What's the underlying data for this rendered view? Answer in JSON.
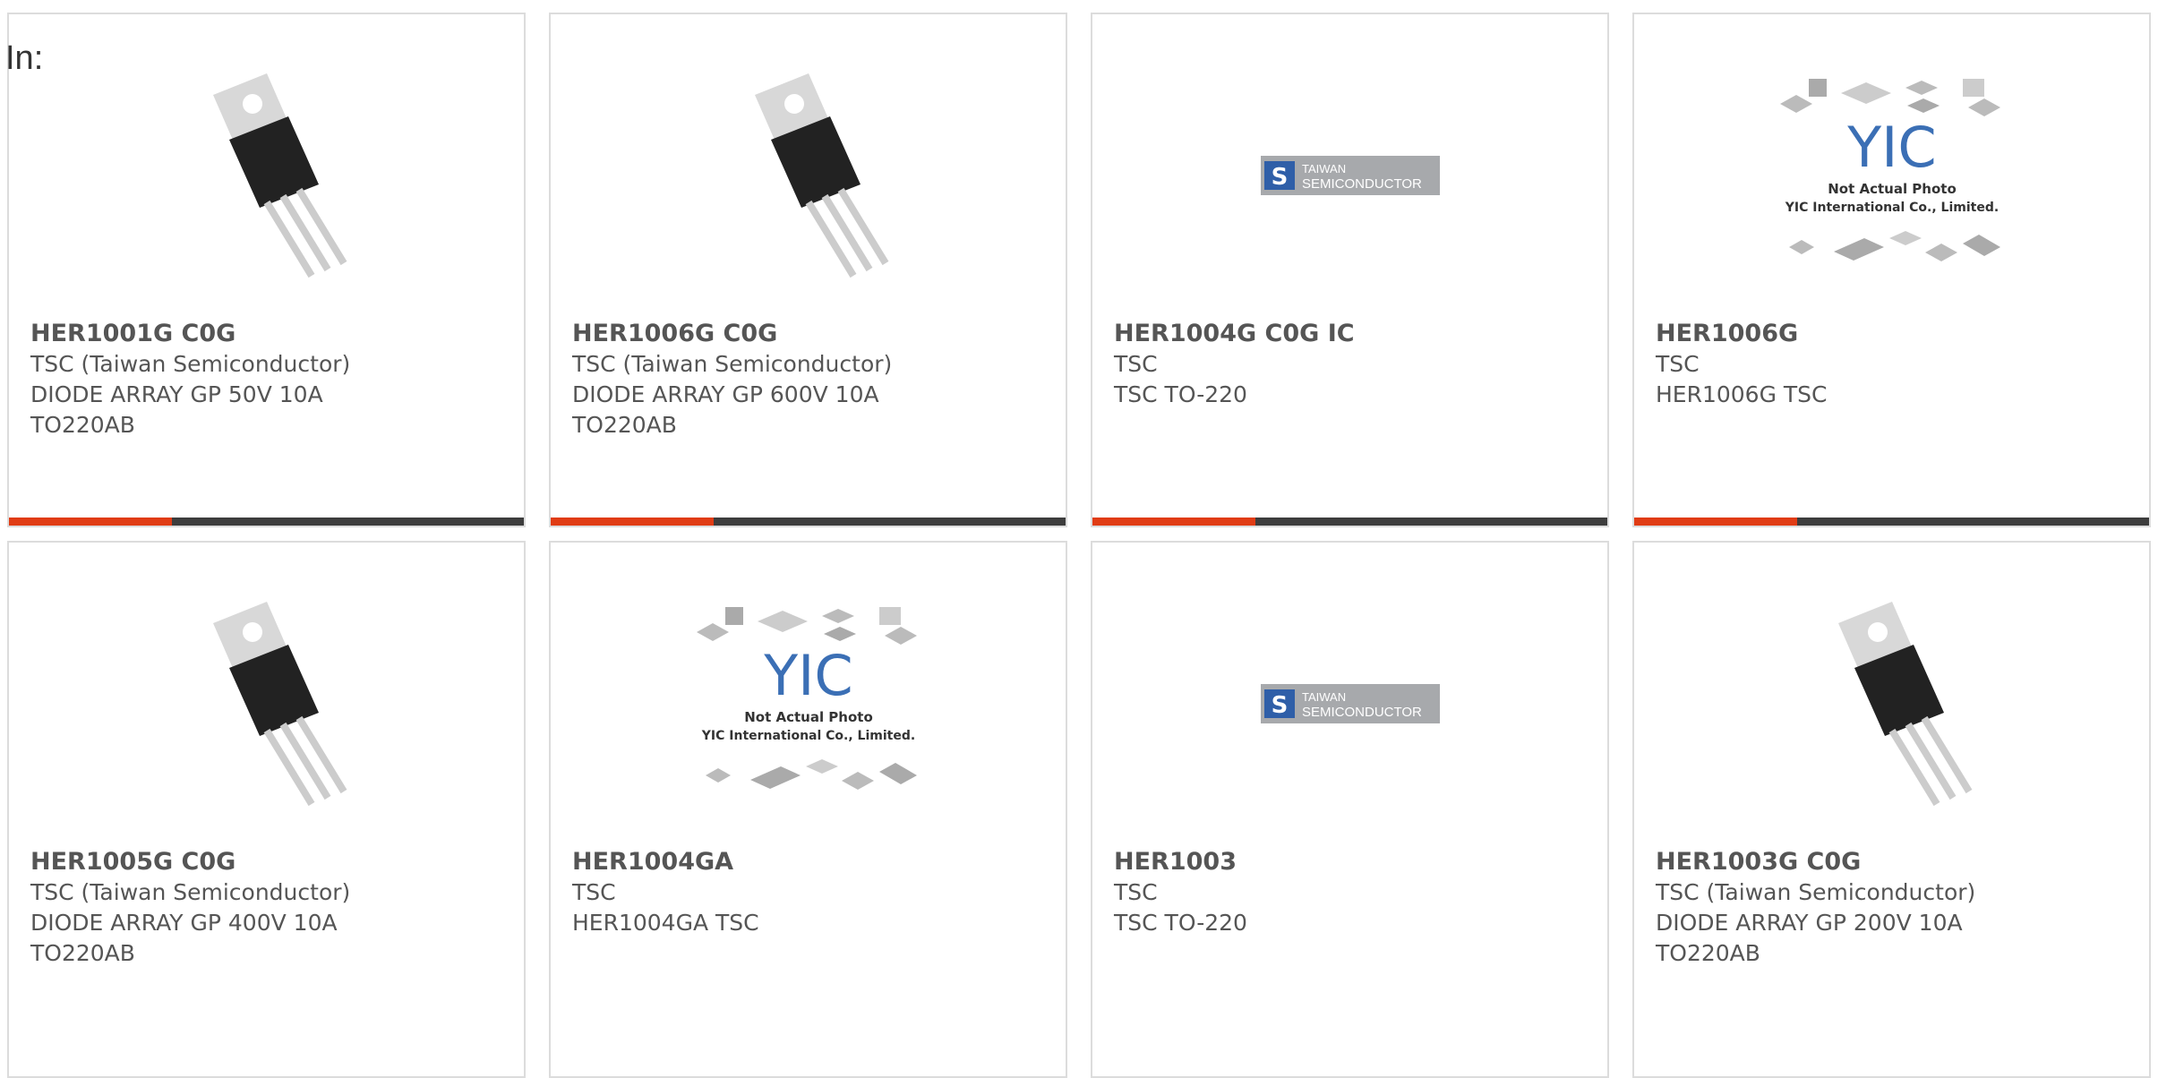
{
  "header": {
    "label": "In:"
  },
  "colors": {
    "accent": "#e03c14",
    "bar": "#3d3d3d",
    "border": "#dcdcdc",
    "text": "#555555"
  },
  "products": [
    {
      "part": "HER1001G C0G",
      "maker": "TSC (Taiwan Semiconductor)",
      "desc1": "DIODE ARRAY GP 50V 10A",
      "desc2": "TO220AB",
      "image": "to220-transistor-icon"
    },
    {
      "part": "HER1006G C0G",
      "maker": "TSC (Taiwan Semiconductor)",
      "desc1": "DIODE ARRAY GP 600V 10A",
      "desc2": "TO220AB",
      "image": "to220-transistor-icon"
    },
    {
      "part": "HER1004G C0G IC",
      "maker": "TSC",
      "desc1": "TSC TO-220",
      "desc2": "",
      "image": "taiwan-semiconductor-logo"
    },
    {
      "part": "HER1006G",
      "maker": "TSC",
      "desc1": "HER1006G TSC",
      "desc2": "",
      "image": "yic-placeholder-image"
    },
    {
      "part": "HER1005G C0G",
      "maker": "TSC (Taiwan Semiconductor)",
      "desc1": "DIODE ARRAY GP 400V 10A",
      "desc2": "TO220AB",
      "image": "to220-transistor-icon"
    },
    {
      "part": "HER1004GA",
      "maker": "TSC",
      "desc1": "HER1004GA TSC",
      "desc2": "",
      "image": "yic-placeholder-image"
    },
    {
      "part": "HER1003",
      "maker": "TSC",
      "desc1": "TSC TO-220",
      "desc2": "",
      "image": "taiwan-semiconductor-logo"
    },
    {
      "part": "HER1003G C0G",
      "maker": "TSC (Taiwan Semiconductor)",
      "desc1": "DIODE ARRAY GP 200V 10A",
      "desc2": "TO220AB",
      "image": "to220-transistor-icon"
    }
  ],
  "logo_text": {
    "line1": "TAIWAN",
    "line2": "SEMICONDUCTOR"
  },
  "yic_text": {
    "brand": "YIC",
    "line1": "Not Actual Photo",
    "line2": "YIC International Co., Limited."
  }
}
